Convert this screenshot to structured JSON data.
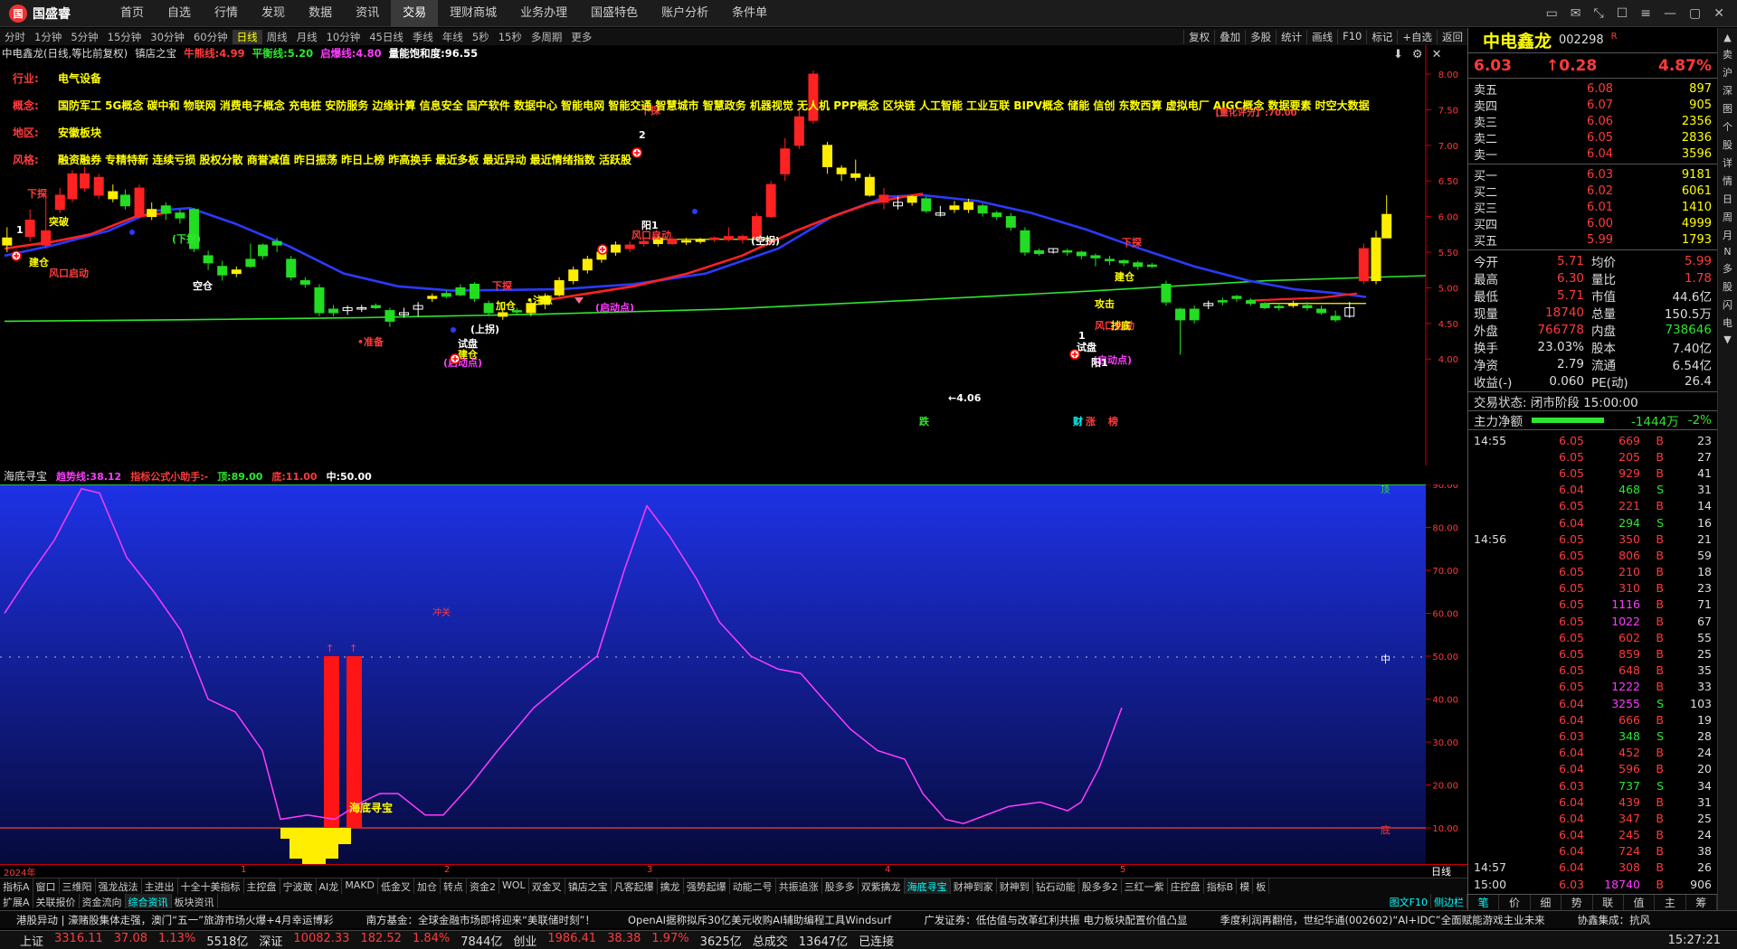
{
  "app": {
    "name": "国盛睿",
    "logo_mark": "国"
  },
  "nav": [
    "首页",
    "自选",
    "行情",
    "发现",
    "数据",
    "资讯",
    "交易",
    "理财商城",
    "业务办理",
    "国盛特色",
    "账户分析",
    "条件单"
  ],
  "nav_active": 6,
  "window_icons": [
    "message-icon",
    "mail-icon",
    "shrink-icon",
    "skin-icon",
    "menu-icon",
    "minimize-icon",
    "maximize-icon",
    "close-icon"
  ],
  "window_glyphs": [
    "▭",
    "✉",
    "⤡",
    "☐",
    "≡",
    "—",
    "▢",
    "✕"
  ],
  "periods": [
    "分时",
    "1分钟",
    "5分钟",
    "15分钟",
    "30分钟",
    "60分钟",
    "日线",
    "周线",
    "月线",
    "10分钟",
    "45日线",
    "季线",
    "年线",
    "5秒",
    "15秒",
    "多周期",
    "更多"
  ],
  "period_active": 6,
  "chart_tools": [
    "复权",
    "叠加",
    "多股",
    "统计",
    "画线",
    "F10",
    "标记",
    "+自选",
    "返回"
  ],
  "main_title": {
    "name": "中电鑫龙(日线,等比前复权)",
    "indicator": "镇店之宝",
    "items": [
      {
        "label": "牛熊线:",
        "val": "4.99",
        "color": "#ff3b3b"
      },
      {
        "label": "平衡线:",
        "val": "5.20",
        "color": "#2ee62e"
      },
      {
        "label": "启爆线:",
        "val": "4.80",
        "color": "#ff3bff"
      },
      {
        "label": "量能饱和度:",
        "val": "96.55",
        "color": "#ffffff"
      }
    ]
  },
  "info_rows": [
    {
      "label": "行业:",
      "text": "电气设备"
    },
    {
      "label": "概念:",
      "text": "国防军工 5G概念 碳中和 物联网 消费电子概念 充电桩 安防服务 边缘计算 信息安全 国产软件 数据中心 智能电网 智能交通 智慧城市 智慧政务 机器视觉 无人机 PPP概念 区块链 人工智能 工业互联 BIPV概念 储能 信创 东数西算 虚拟电厂 AIGC概念 数据要素 时空大数据"
    },
    {
      "label": "地区:",
      "text": "安徽板块"
    },
    {
      "label": "风格:",
      "text": "融资融券 专精特新 连续亏损 股权分散 商誉减值 昨日振荡 昨日上榜 昨高换手 最近多板 最近异动 最近情绪指数 活跃股"
    }
  ],
  "quant_score": "【量化评分】:70.00",
  "y_axis": [
    "8.00",
    "7.50",
    "7.00",
    "6.50",
    "6.00",
    "5.50",
    "5.00",
    "4.50",
    "4.00"
  ],
  "annotations": [
    {
      "t": "下探",
      "c": "#ff3b3b"
    },
    {
      "t": "突破",
      "c": "#ffff00"
    },
    {
      "t": "建仓",
      "c": "#ffff00"
    },
    {
      "t": "风口启动",
      "c": "#ff3b3b"
    },
    {
      "t": "(下拐)",
      "c": "#2ee62e"
    },
    {
      "t": "空仓",
      "c": "#ffffff"
    },
    {
      "t": "•准备",
      "c": "#ff3b3b"
    },
    {
      "t": "下探",
      "c": "#ff3b3b"
    },
    {
      "t": "加仓",
      "c": "#ffff00"
    },
    {
      "t": "•注意",
      "c": "#ffff00"
    },
    {
      "t": "(上拐)",
      "c": "#ffffff"
    },
    {
      "t": "试盘",
      "c": "#ffffff"
    },
    {
      "t": "建仓",
      "c": "#ffff00"
    },
    {
      "t": "(启动点)",
      "c": "#ff3bff"
    },
    {
      "t": "(启动点)",
      "c": "#ff3bff"
    },
    {
      "t": "(启动点)",
      "c": "#ff3bff"
    },
    {
      "t": "下探",
      "c": "#ff3b3b"
    },
    {
      "t": "风口启动",
      "c": "#ff3b3b"
    },
    {
      "t": "阳1",
      "c": "#ffffff"
    },
    {
      "t": "(空拐)",
      "c": "#ffffff"
    },
    {
      "t": "←4.06",
      "c": "#ffffff"
    },
    {
      "t": "下探",
      "c": "#ff3b3b"
    },
    {
      "t": "攻击",
      "c": "#ffff00"
    },
    {
      "t": "风口启动",
      "c": "#ff3b3b"
    },
    {
      "t": "试盘",
      "c": "#ffffff"
    },
    {
      "t": "阳1",
      "c": "#ffffff"
    },
    {
      "t": "抄底",
      "c": "#ffff00"
    },
    {
      "t": "建仓",
      "c": "#ffff00"
    },
    {
      "t": "1",
      "c": "#ffffff"
    },
    {
      "t": "1",
      "c": "#ffffff"
    },
    {
      "t": "2",
      "c": "#ffffff"
    },
    {
      "t": "跌",
      "c": "#2ee62e"
    },
    {
      "t": "财",
      "c": "#0ff"
    },
    {
      "t": "涨",
      "c": "#ff3b3b"
    },
    {
      "t": "榜",
      "c": "#ff3b3b"
    }
  ],
  "sub_title": {
    "name": "海底寻宝",
    "items": [
      {
        "label": "趋势线:",
        "val": "38.12",
        "color": "#ff3bff"
      },
      {
        "label": "指标公式小助手:",
        "val": "-",
        "color": "#ff3b3b"
      },
      {
        "label": "顶:",
        "val": "89.00",
        "color": "#2ee62e"
      },
      {
        "label": "底:",
        "val": "11.00",
        "color": "#ff3b3b"
      },
      {
        "label": "中:",
        "val": "50.00",
        "color": "#ffffff"
      }
    ]
  },
  "sub_y_axis": [
    "90.00",
    "80.00",
    "70.00",
    "60.00",
    "50.00",
    "40.00",
    "30.00",
    "20.00",
    "10.00"
  ],
  "sub_labels": {
    "top": "顶",
    "mid": "中",
    "bot": "底",
    "bottom_text": "海底寻宝",
    "red_text": "冲关"
  },
  "x_axis": [
    "2024年",
    "1",
    "2",
    "3",
    "4",
    "5"
  ],
  "x_period": "日线",
  "tabs1": [
    "指标A",
    "窗口",
    "三维阳",
    "强龙战法",
    "主进出",
    "十全十美指标",
    "主控盘",
    "宁波敢",
    "AI龙",
    "MAKD",
    "低金叉",
    "加仓",
    "转点",
    "资金2",
    "WOL",
    "双金叉",
    "镇店之宝",
    "凡客起爆",
    "擒龙",
    "强势起爆",
    "动能二号",
    "共振追涨",
    "股多多",
    "双紫擒龙",
    "海底寻宝",
    "财神到家",
    "财神到",
    "钻石动能",
    "股多多2",
    "三红一紫",
    "庄控盘",
    "指标B",
    "模",
    "板"
  ],
  "tabs1_active": 24,
  "tabs2": [
    "扩展A",
    "关联报价",
    "资金流向",
    "综合资讯",
    "板块资讯"
  ],
  "tabs2_right": [
    "图文F10",
    "侧边栏"
  ],
  "stock": {
    "name": "中电鑫龙",
    "code": "002298",
    "mark": "R",
    "price": "6.03",
    "change": "0.28",
    "pct": "4.87%"
  },
  "asks": [
    {
      "l": "卖五",
      "p": "6.08",
      "v": "897"
    },
    {
      "l": "卖四",
      "p": "6.07",
      "v": "905"
    },
    {
      "l": "卖三",
      "p": "6.06",
      "v": "2356"
    },
    {
      "l": "卖二",
      "p": "6.05",
      "v": "2836"
    },
    {
      "l": "卖一",
      "p": "6.04",
      "v": "3596"
    }
  ],
  "bids": [
    {
      "l": "买一",
      "p": "6.03",
      "v": "9181"
    },
    {
      "l": "买二",
      "p": "6.02",
      "v": "6061"
    },
    {
      "l": "买三",
      "p": "6.01",
      "v": "1410"
    },
    {
      "l": "买四",
      "p": "6.00",
      "v": "4999"
    },
    {
      "l": "买五",
      "p": "5.99",
      "v": "1793"
    }
  ],
  "quotes": [
    {
      "k": "今开",
      "v": "5.71",
      "vc": "up",
      "k2": "均价",
      "v2": "5.99",
      "v2c": "up"
    },
    {
      "k": "最高",
      "v": "6.30",
      "vc": "up",
      "k2": "量比",
      "v2": "1.78",
      "v2c": "up"
    },
    {
      "k": "最低",
      "v": "5.71",
      "vc": "up",
      "k2": "市值",
      "v2": "44.6亿",
      "v2c": "wh"
    },
    {
      "k": "现量",
      "v": "18740",
      "vc": "up",
      "k2": "总量",
      "v2": "150.5万",
      "v2c": "wh"
    },
    {
      "k": "外盘",
      "v": "766778",
      "vc": "up",
      "k2": "内盘",
      "v2": "738646",
      "v2c": "dn"
    },
    {
      "k": "换手",
      "v": "23.03%",
      "vc": "wh",
      "k2": "股本",
      "v2": "7.40亿",
      "v2c": "wh"
    },
    {
      "k": "净资",
      "v": "2.79",
      "vc": "wh",
      "k2": "流通",
      "v2": "6.54亿",
      "v2c": "wh"
    },
    {
      "k": "收益(-)",
      "v": "0.060",
      "vc": "wh",
      "k2": "PE(动)",
      "v2": "26.4",
      "v2c": "wh"
    }
  ],
  "trade_state": "交易状态: 闭市阶段 15:00:00",
  "net_flow": {
    "label": "主力净额",
    "val": "-1444万",
    "pct": "-2%"
  },
  "ticks": [
    {
      "t": "14:55",
      "p": "6.05",
      "v": "669",
      "s": "B",
      "n": "23"
    },
    {
      "t": "",
      "p": "6.05",
      "v": "205",
      "s": "B",
      "n": "27"
    },
    {
      "t": "",
      "p": "6.05",
      "v": "929",
      "s": "B",
      "n": "41"
    },
    {
      "t": "",
      "p": "6.04",
      "v": "468",
      "s": "S",
      "n": "31"
    },
    {
      "t": "",
      "p": "6.05",
      "v": "221",
      "s": "B",
      "n": "14"
    },
    {
      "t": "",
      "p": "6.04",
      "v": "294",
      "s": "S",
      "n": "16"
    },
    {
      "t": "14:56",
      "p": "6.05",
      "v": "350",
      "s": "B",
      "n": "21"
    },
    {
      "t": "",
      "p": "6.05",
      "v": "806",
      "s": "B",
      "n": "59"
    },
    {
      "t": "",
      "p": "6.05",
      "v": "210",
      "s": "B",
      "n": "18"
    },
    {
      "t": "",
      "p": "6.05",
      "v": "310",
      "s": "B",
      "n": "23"
    },
    {
      "t": "",
      "p": "6.05",
      "v": "1116",
      "s": "B",
      "n": "71"
    },
    {
      "t": "",
      "p": "6.05",
      "v": "1022",
      "s": "B",
      "n": "67"
    },
    {
      "t": "",
      "p": "6.05",
      "v": "602",
      "s": "B",
      "n": "55"
    },
    {
      "t": "",
      "p": "6.05",
      "v": "859",
      "s": "B",
      "n": "25"
    },
    {
      "t": "",
      "p": "6.05",
      "v": "648",
      "s": "B",
      "n": "35"
    },
    {
      "t": "",
      "p": "6.05",
      "v": "1222",
      "s": "B",
      "n": "33"
    },
    {
      "t": "",
      "p": "6.04",
      "v": "3255",
      "s": "S",
      "n": "103"
    },
    {
      "t": "",
      "p": "6.04",
      "v": "666",
      "s": "B",
      "n": "19"
    },
    {
      "t": "",
      "p": "6.03",
      "v": "348",
      "s": "S",
      "n": "28"
    },
    {
      "t": "",
      "p": "6.04",
      "v": "452",
      "s": "B",
      "n": "24"
    },
    {
      "t": "",
      "p": "6.04",
      "v": "596",
      "s": "B",
      "n": "20"
    },
    {
      "t": "",
      "p": "6.03",
      "v": "737",
      "s": "S",
      "n": "34"
    },
    {
      "t": "",
      "p": "6.04",
      "v": "439",
      "s": "B",
      "n": "31"
    },
    {
      "t": "",
      "p": "6.04",
      "v": "347",
      "s": "B",
      "n": "25"
    },
    {
      "t": "",
      "p": "6.04",
      "v": "245",
      "s": "B",
      "n": "24"
    },
    {
      "t": "",
      "p": "6.04",
      "v": "724",
      "s": "B",
      "n": "38"
    },
    {
      "t": "14:57",
      "p": "6.04",
      "v": "308",
      "s": "B",
      "n": "26"
    },
    {
      "t": "15:00",
      "p": "6.03",
      "v": "18740",
      "s": "B",
      "n": "906"
    }
  ],
  "rp_tabs": [
    "笔",
    "价",
    "细",
    "势",
    "联",
    "值",
    "主",
    "筹"
  ],
  "vbar": [
    "▲",
    "卖",
    "沪",
    "深",
    "图",
    "个",
    "股",
    "详",
    "情",
    "日",
    "周",
    "月",
    "N",
    "多",
    "股",
    "闪",
    "电",
    "▼"
  ],
  "news": [
    "港股异动 | 濠赌股集体走强，澳门“五一”旅游市场火爆+4月幸运博彩",
    "南方基金：全球金融市场即将迎来“美联储时刻”！",
    "OpenAI据称拟斥30亿美元收购AI辅助编程工具Windsurf",
    "广发证券：低估值与改革红利共振 电力板块配置价值凸显",
    "季度利润再翻倍，世纪华通(002602)“AI+IDC”全面赋能游戏主业未来",
    "协鑫集成：抗风"
  ],
  "status": [
    {
      "t": "上证",
      "c": "wh"
    },
    {
      "t": "3316.11",
      "c": "up"
    },
    {
      "t": "37.08",
      "c": "up"
    },
    {
      "t": "1.13%",
      "c": "up"
    },
    {
      "t": "5518亿",
      "c": "wh"
    },
    {
      "t": "深证",
      "c": "wh"
    },
    {
      "t": "10082.33",
      "c": "up"
    },
    {
      "t": "182.52",
      "c": "up"
    },
    {
      "t": "1.84%",
      "c": "up"
    },
    {
      "t": "7844亿",
      "c": "wh"
    },
    {
      "t": "创业",
      "c": "wh"
    },
    {
      "t": "1986.41",
      "c": "up"
    },
    {
      "t": "38.38",
      "c": "up"
    },
    {
      "t": "1.97%",
      "c": "up"
    },
    {
      "t": "3625亿",
      "c": "wh"
    },
    {
      "t": "总成交",
      "c": "wh"
    },
    {
      "t": "13647亿",
      "c": "wh"
    },
    {
      "t": "已连接",
      "c": "wh"
    }
  ],
  "clock": "15:27:21",
  "colors": {
    "up": "#ff3b3b",
    "down": "#2ee62e",
    "blue_ma": "#2a3bff",
    "sub_bg_top": "#1e32e6",
    "sub_bg_bot": "#060a3c"
  }
}
